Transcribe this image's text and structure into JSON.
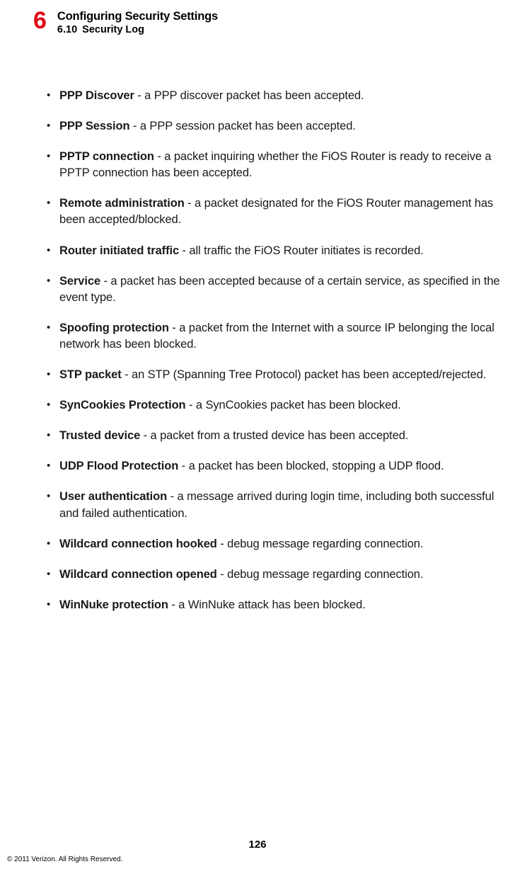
{
  "header": {
    "chapter_number": "6",
    "chapter_title": "Configuring Security Settings",
    "section_number": "6.10",
    "section_title": "Security Log"
  },
  "definitions": [
    {
      "term": "PPP Discover",
      "desc": " - a PPP discover packet has been accepted."
    },
    {
      "term": "PPP Session",
      "desc": " - a PPP session packet has been accepted."
    },
    {
      "term": "PPTP connection",
      "desc": " - a packet inquiring whether the FiOS Router is ready to receive a PPTP connection has been accepted."
    },
    {
      "term": "Remote administration",
      "desc": " - a packet designated for the FiOS Router management has been accepted/blocked."
    },
    {
      "term": "Router initiated traffic",
      "desc": " - all traffic the FiOS Router initiates is recorded."
    },
    {
      "term": "Service",
      "desc": " - a packet has been accepted because of a certain service, as specified in the event type."
    },
    {
      "term": "Spoofing protection",
      "desc": " - a packet from the Internet with a source IP belonging the local network has been blocked."
    },
    {
      "term": "STP packet",
      "desc": " - an STP (Spanning Tree Protocol) packet has been accepted/rejected."
    },
    {
      "term": "SynCookies Protection",
      "desc": " - a SynCookies packet has been blocked."
    },
    {
      "term": "Trusted device",
      "desc": " - a packet from a trusted device has been accepted."
    },
    {
      "term": "UDP Flood Protection",
      "desc": " - a packet has been blocked, stopping a UDP flood."
    },
    {
      "term": "User authentication",
      "desc": " - a message arrived during login time, including both successful and failed authentication."
    },
    {
      "term": "Wildcard connection hooked",
      "desc": " - debug message regarding connection."
    },
    {
      "term": "Wildcard connection opened",
      "desc": " - debug message regarding connection."
    },
    {
      "term": "WinNuke protection",
      "desc": " - a WinNuke attack has been blocked."
    }
  ],
  "footer": {
    "page_number": "126",
    "copyright": "© 2011 Verizon. All Rights Reserved."
  }
}
